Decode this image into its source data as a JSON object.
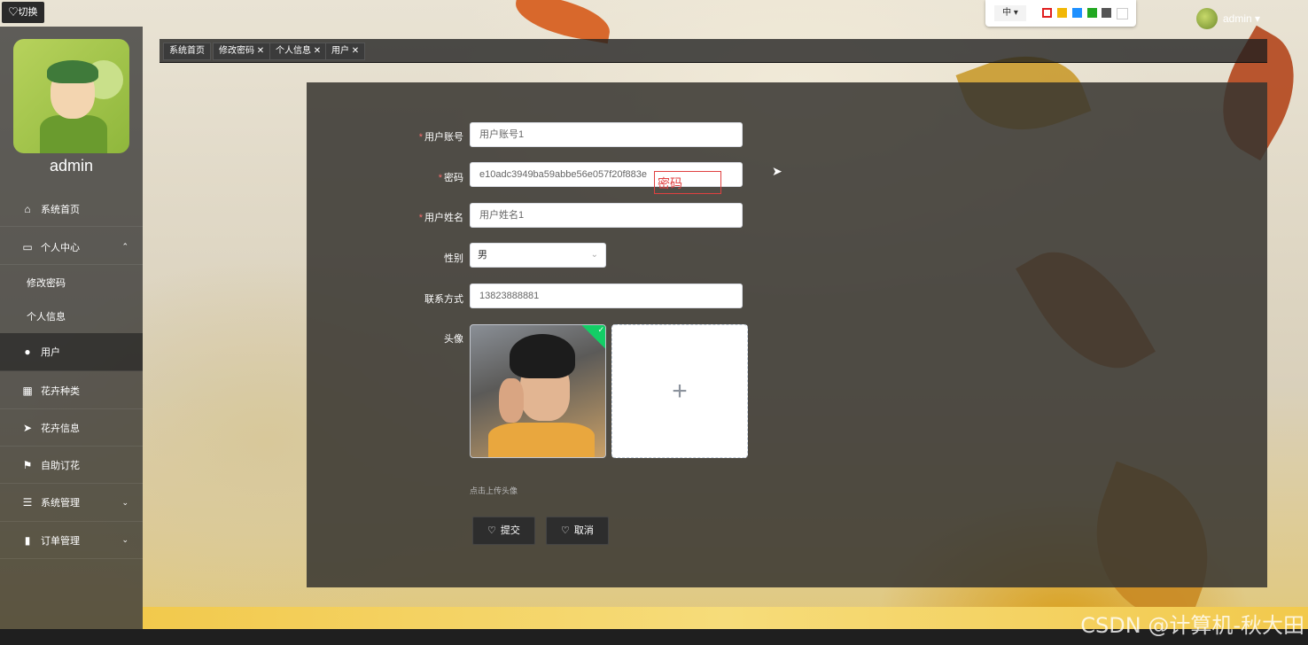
{
  "topbar": {
    "switch_label": "♡切换",
    "lang_label": "中 ▾",
    "theme_colors": [
      "#e02020",
      "#f2b705",
      "#1e90ff",
      "#22a822",
      "#555555",
      "#ffffff"
    ],
    "user_name": "admin ▾"
  },
  "sidebar": {
    "avatar_name": "admin",
    "items": [
      {
        "label": "系统首页",
        "icon": "home-icon"
      },
      {
        "label": "个人中心",
        "icon": "card-icon",
        "chevron": "⌃"
      },
      {
        "label": "修改密码"
      },
      {
        "label": "个人信息"
      },
      {
        "label": "用户",
        "icon": "bulb-icon"
      },
      {
        "label": "花卉种类",
        "icon": "grid-icon"
      },
      {
        "label": "花卉信息",
        "icon": "send-icon"
      },
      {
        "label": "自助订花",
        "icon": "flag-icon"
      },
      {
        "label": "系统管理",
        "icon": "list-icon",
        "chevron": "⌄"
      },
      {
        "label": "订单管理",
        "icon": "chart-icon",
        "chevron": "⌄"
      }
    ]
  },
  "tabs": [
    {
      "label": "系统首页"
    },
    {
      "label": "修改密码 ✕"
    },
    {
      "label": "个人信息 ✕"
    },
    {
      "label": "用户 ✕"
    }
  ],
  "form": {
    "account_label": "用户账号",
    "account_value": "用户账号1",
    "password_label": "密码",
    "password_value": "e10adc3949ba59abbe56e057f20f883e",
    "password_tooltip": "密码",
    "name_label": "用户姓名",
    "name_value": "用户姓名1",
    "sex_label": "性别",
    "sex_value": "男",
    "phone_label": "联系方式",
    "phone_value": "13823888881",
    "avatar_label": "头像",
    "upload_plus": "+",
    "upload_hint": "点击上传头像",
    "submit_label": "提交",
    "cancel_label": "取消",
    "required_mark": "*"
  },
  "watermark": "CSDN @计算机-秋大田"
}
